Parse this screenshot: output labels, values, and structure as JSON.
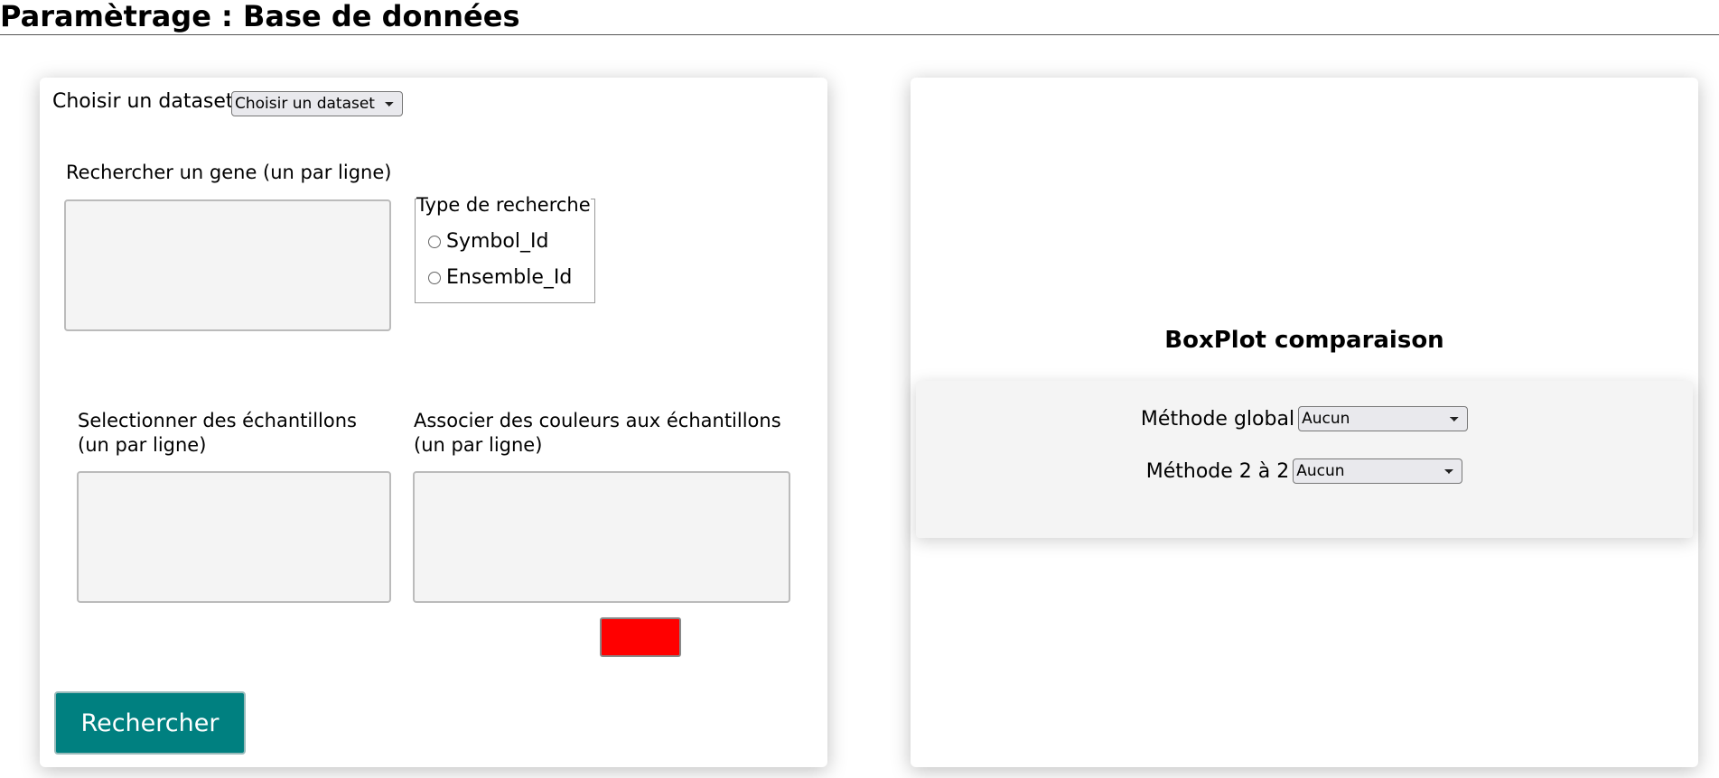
{
  "header": {
    "title": "Paramètrage : Base de données"
  },
  "left_panel": {
    "dataset_label": "Choisir un dataset",
    "dataset_select": {
      "selected": "Choisir un dataset"
    },
    "gene_search_label": "Rechercher un gene (un par ligne)",
    "gene_search_value": "",
    "search_type": {
      "legend": "Type de recherche",
      "options": [
        "Symbol_Id",
        "Ensemble_Id"
      ]
    },
    "samples_label_line1": "Selectionner des échantillons",
    "samples_label_line2": "(un par ligne)",
    "samples_value": "",
    "colors_label_line1": "Associer des couleurs aux échantillons",
    "colors_label_line2": "(un par ligne)",
    "colors_value": "",
    "color_picker_value": "#ff0000",
    "search_button": "Rechercher"
  },
  "right_panel": {
    "title": "BoxPlot comparaison",
    "global_method_label": "Méthode global",
    "global_method_selected": "Aucun",
    "pairwise_method_label": "Méthode 2 à 2",
    "pairwise_method_selected": "Aucun"
  },
  "colors": {
    "accent": "#008080",
    "swatch": "#ff0000"
  }
}
